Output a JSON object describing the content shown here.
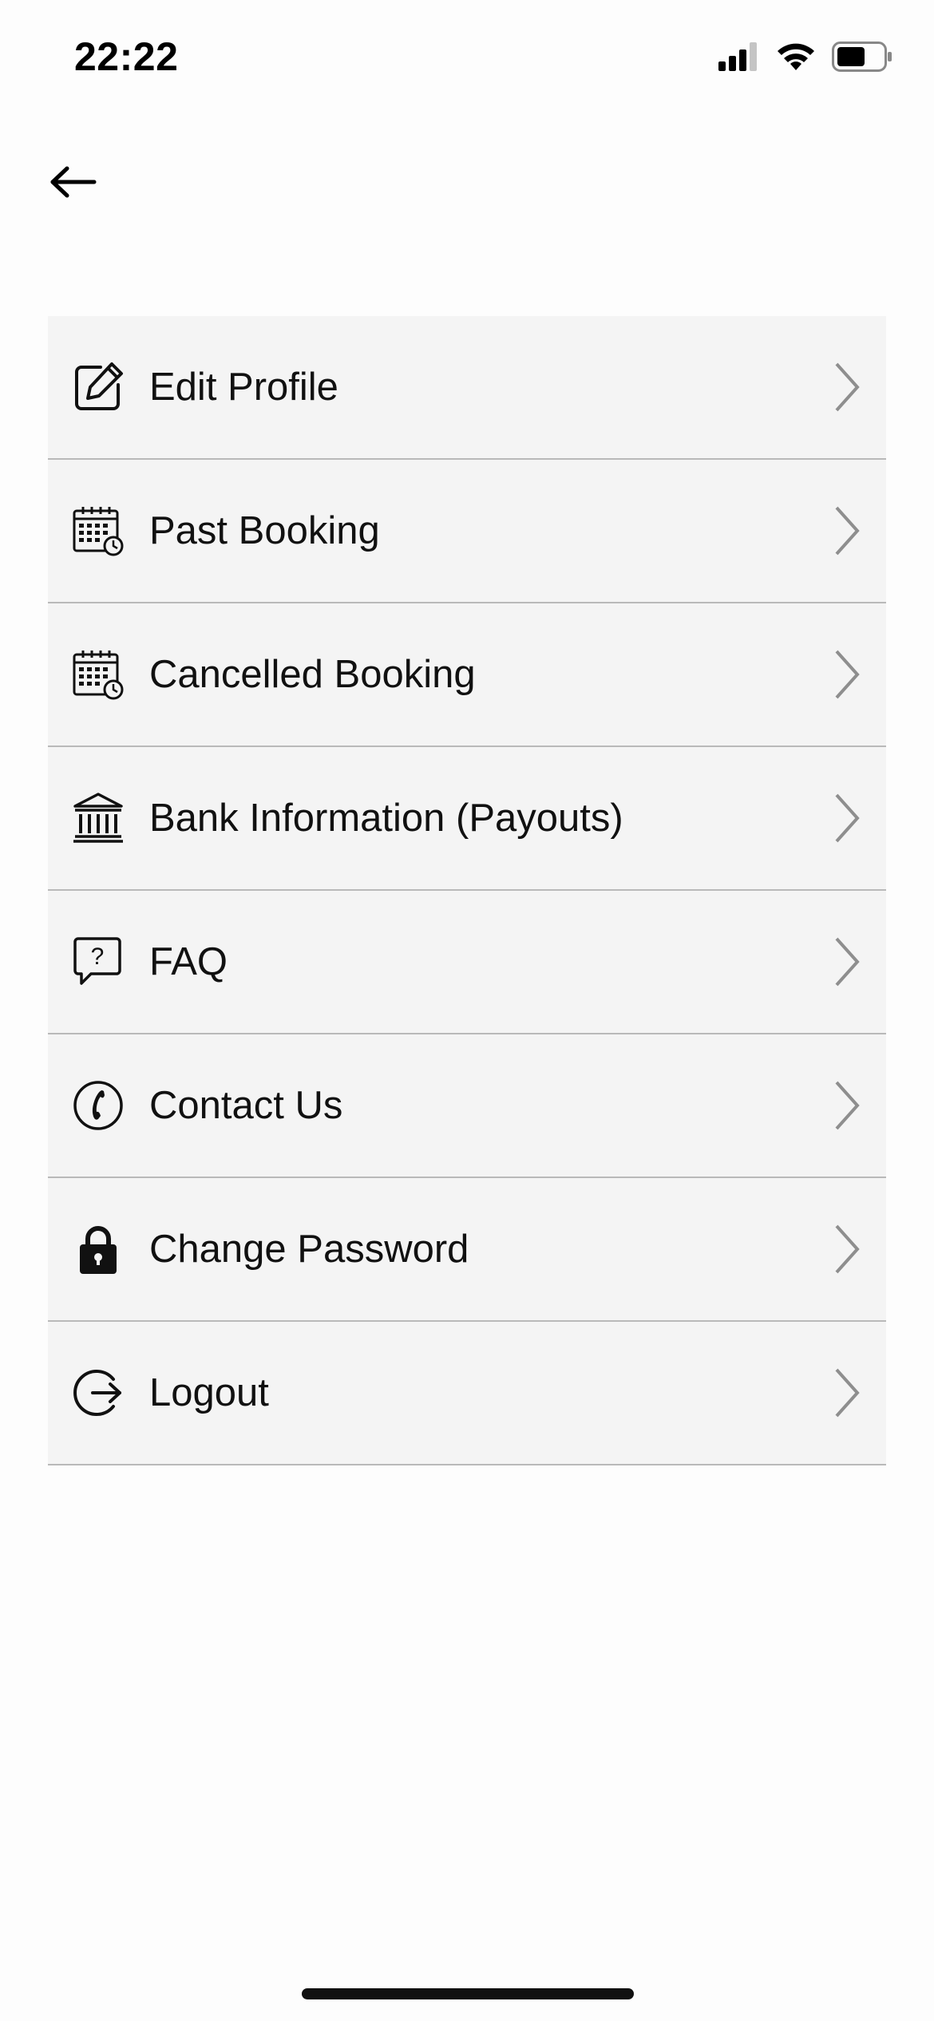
{
  "status_bar": {
    "time": "22:22",
    "signal_icon": "cellular-signal-icon",
    "wifi_icon": "wifi-icon",
    "battery_icon": "battery-icon"
  },
  "header": {
    "back_icon": "arrow-left-icon"
  },
  "menu": {
    "items": [
      {
        "label": "Edit Profile",
        "icon": "edit-icon"
      },
      {
        "label": "Past Booking",
        "icon": "calendar-clock-icon"
      },
      {
        "label": "Cancelled Booking",
        "icon": "calendar-clock-icon"
      },
      {
        "label": "Bank Information (Payouts)",
        "icon": "bank-icon"
      },
      {
        "label": "FAQ",
        "icon": "question-bubble-icon"
      },
      {
        "label": "Contact Us",
        "icon": "phone-icon"
      },
      {
        "label": "Change Password",
        "icon": "lock-icon"
      },
      {
        "label": "Logout",
        "icon": "logout-icon"
      }
    ]
  },
  "colors": {
    "row_background": "#f4f4f4",
    "divider": "#b9b9b9",
    "chevron": "#8e8e8e",
    "page_background": "#fdfdfd"
  }
}
